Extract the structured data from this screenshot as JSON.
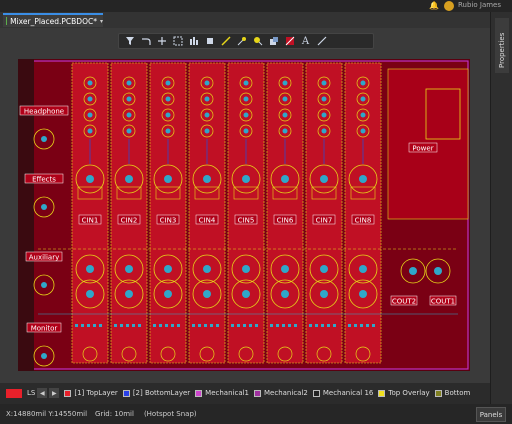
{
  "app": {
    "tab_title": "Mixer_Placed.PCBDOC",
    "tab_modified": "*",
    "user": "Rubio James"
  },
  "right_panel": {
    "properties_label": "Properties"
  },
  "toolbar": {
    "tools": [
      "filter",
      "route",
      "add",
      "select-rect",
      "align",
      "place-component",
      "place-track",
      "place-via",
      "place-pad",
      "place-fill",
      "region",
      "text",
      "line"
    ]
  },
  "board": {
    "labels": {
      "headphone": "Headphone",
      "effects": "Effects",
      "auxiliary": "Auxiliary",
      "monitor": "Monitor",
      "power": "Power",
      "cin": [
        "CIN1",
        "CIN2",
        "CIN3",
        "CIN4",
        "CIN5",
        "CIN6",
        "CIN7",
        "CIN8"
      ],
      "cout1": "COUT1",
      "cout2": "COUT2"
    },
    "colors": {
      "board": "#7a0014",
      "top_copper": "#c01024",
      "overlay": "#e6d619",
      "pad": "#2fa7c9",
      "outline": "#c030c0",
      "bottom": "#3347c8"
    }
  },
  "layers": {
    "ls": "LS",
    "items": [
      {
        "label": "[1] TopLayer",
        "color": "#e8202a",
        "active": true
      },
      {
        "label": "[2] BottomLayer",
        "color": "#2840e8"
      },
      {
        "label": "Mechanical1",
        "color": "#cc44cc"
      },
      {
        "label": "Mechanical2",
        "color": "#a030a0"
      },
      {
        "label": "Mechanical 16",
        "color": "#222222"
      },
      {
        "label": "Top Overlay",
        "color": "#f0e020"
      },
      {
        "label": "Bottom",
        "color": "#808020"
      }
    ]
  },
  "status": {
    "coords": "X:14880mil Y:14550mil",
    "grid": "Grid: 10mil",
    "snap": "(Hotspot Snap)",
    "panels_label": "Panels"
  }
}
